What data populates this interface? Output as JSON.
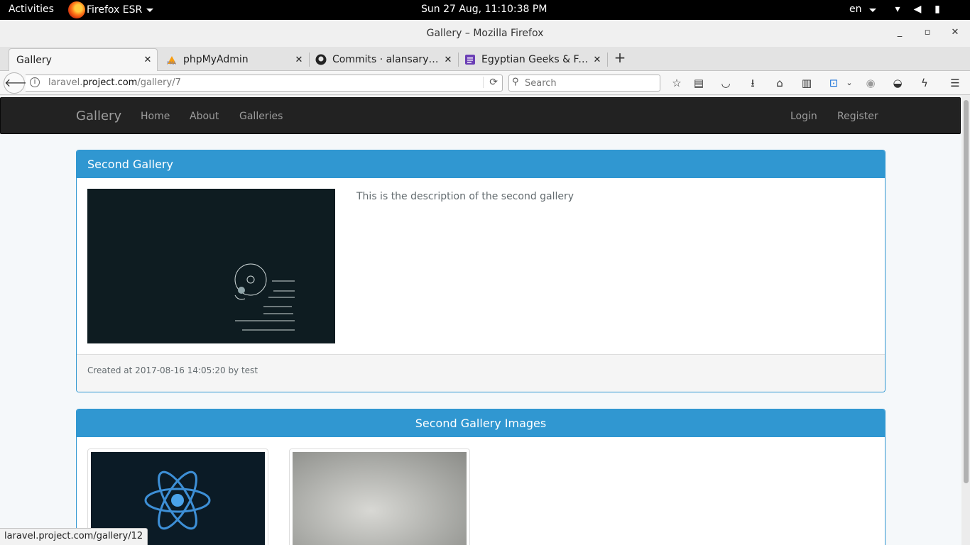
{
  "system": {
    "activities": "Activities",
    "app_name": "Firefox ESR",
    "clock": "Sun 27 Aug, 11:10:38 PM",
    "language": "en"
  },
  "window": {
    "title": "Gallery – Mozilla Firefox"
  },
  "tabs": [
    {
      "title": "Gallery",
      "active": true
    },
    {
      "title": "phpMyAdmin",
      "favicon": "phpmyadmin-icon"
    },
    {
      "title": "Commits · alansary/L...",
      "favicon": "github-icon"
    },
    {
      "title": "Egyptian Geeks & Fa...",
      "favicon": "list-icon"
    }
  ],
  "navigation": {
    "url_prefix": "laravel.",
    "url_domain": "project.com",
    "url_path": "/gallery/7",
    "search_placeholder": "Search"
  },
  "site": {
    "brand": "Gallery",
    "nav": [
      "Home",
      "About",
      "Galleries"
    ],
    "auth": [
      "Login",
      "Register"
    ]
  },
  "gallery": {
    "title": "Second Gallery",
    "description": "This is the description of the second gallery",
    "created": "Created at 2017-08-16 14:05:20 by test",
    "images_title": "Second Gallery Images"
  },
  "status_url": "laravel.project.com/gallery/12",
  "colors": {
    "panel_primary": "#3097d1",
    "navbar": "#222222",
    "page_bg": "#f5f8fa"
  }
}
